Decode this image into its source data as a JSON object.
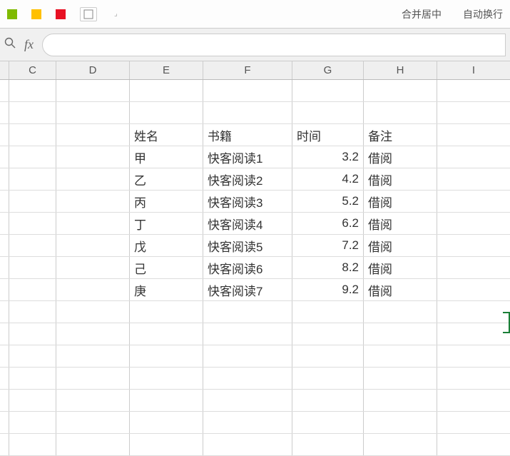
{
  "toolbar": {
    "text1": "合并居中",
    "text2": "自动换行"
  },
  "formula_bar": {
    "value": ""
  },
  "columns": {
    "c": "C",
    "d": "D",
    "e": "E",
    "f": "F",
    "g": "G",
    "h": "H",
    "i": "I"
  },
  "table": {
    "headers": {
      "name": "姓名",
      "book": "书籍",
      "time": "时间",
      "note": "备注"
    },
    "rows": [
      {
        "name": "甲",
        "book": "快客阅读1",
        "time": "3.2",
        "note": "借阅"
      },
      {
        "name": "乙",
        "book": "快客阅读2",
        "time": "4.2",
        "note": "借阅"
      },
      {
        "name": "丙",
        "book": "快客阅读3",
        "time": "5.2",
        "note": "借阅"
      },
      {
        "name": "丁",
        "book": "快客阅读4",
        "time": "6.2",
        "note": "借阅"
      },
      {
        "name": "戊",
        "book": "快客阅读5",
        "time": "7.2",
        "note": "借阅"
      },
      {
        "name": "己",
        "book": "快客阅读6",
        "time": "8.2",
        "note": "借阅"
      },
      {
        "name": "庚",
        "book": "快客阅读7",
        "time": "9.2",
        "note": "借阅"
      }
    ]
  }
}
